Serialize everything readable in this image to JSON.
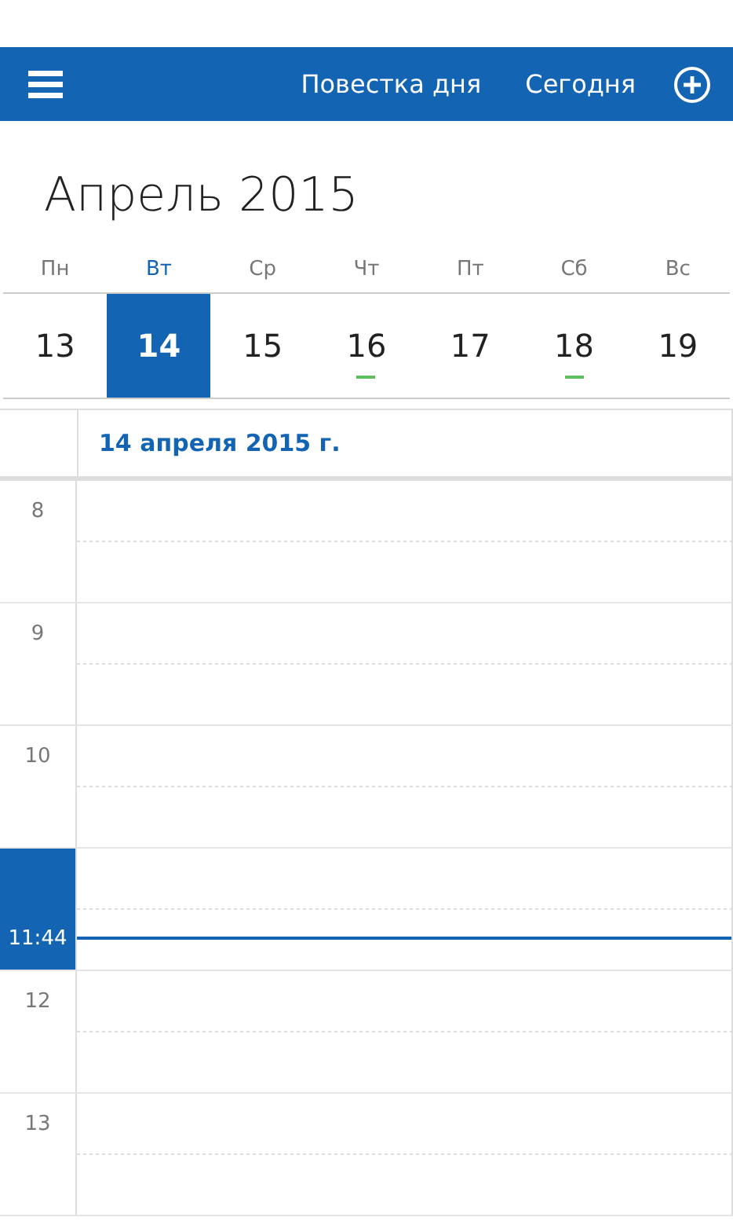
{
  "top_bar": {
    "actions": [
      "Повестка дня",
      "Сегодня"
    ]
  },
  "month_title": "Апрель 2015",
  "week": [
    {
      "weekday": "Пн",
      "date": "13",
      "selected": false,
      "has_event": false
    },
    {
      "weekday": "Вт",
      "date": "14",
      "selected": true,
      "has_event": false
    },
    {
      "weekday": "Ср",
      "date": "15",
      "selected": false,
      "has_event": false
    },
    {
      "weekday": "Чт",
      "date": "16",
      "selected": false,
      "has_event": true
    },
    {
      "weekday": "Пт",
      "date": "17",
      "selected": false,
      "has_event": false
    },
    {
      "weekday": "Сб",
      "date": "18",
      "selected": false,
      "has_event": true
    },
    {
      "weekday": "Вс",
      "date": "19",
      "selected": false,
      "has_event": false
    }
  ],
  "day_header": "14 апреля 2015 г.",
  "hours": [
    {
      "kind": "hour",
      "label": "8"
    },
    {
      "kind": "hour",
      "label": "9"
    },
    {
      "kind": "hour",
      "label": "10"
    },
    {
      "kind": "now",
      "label": "11:44"
    },
    {
      "kind": "hour",
      "label": "12"
    },
    {
      "kind": "hour",
      "label": "13"
    }
  ]
}
